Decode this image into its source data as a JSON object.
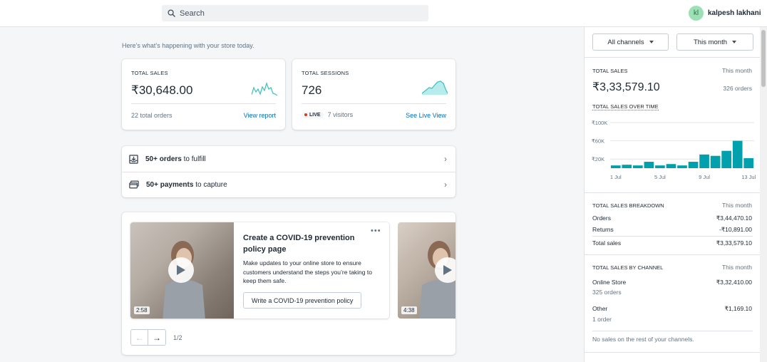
{
  "search": {
    "placeholder": "Search"
  },
  "user": {
    "initials": "kl",
    "name": "kalpesh lakhani"
  },
  "intro": "Here’s what’s happening with your store today.",
  "total_sales_card": {
    "label": "TOTAL SALES",
    "value": "₹30,648.00",
    "orders_text": "22 total orders",
    "link": "View report"
  },
  "sessions_card": {
    "label": "TOTAL SESSIONS",
    "value": "726",
    "live_label": "LIVE",
    "visitors_text": "7 visitors",
    "link": "See Live View"
  },
  "tasks": [
    {
      "count": "50+ orders",
      "rest": " to fulfill"
    },
    {
      "count": "50+ payments",
      "rest": " to capture"
    }
  ],
  "video": {
    "title": "Create a COVID-19 prevention policy page",
    "description": "Make updates to your online store to ensure customers understand the steps you’re taking to keep them safe.",
    "button": "Write a COVID-19 prevention policy",
    "duration": "2:58",
    "next_duration": "4:38",
    "menu": "•••",
    "pager_text": "1/2"
  },
  "right_panel": {
    "channel_select": "All channels",
    "period_select": "This month",
    "total_sales": {
      "label": "TOTAL SALES",
      "period": "This month",
      "value": "₹3,33,579.10",
      "orders": "326 orders",
      "over_time_label": "TOTAL SALES OVER TIME"
    },
    "breakdown": {
      "label": "TOTAL SALES BREAKDOWN",
      "period": "This month",
      "rows": [
        {
          "label": "Orders",
          "value": "₹3,44,470.10"
        },
        {
          "label": "Returns",
          "value": "-₹10,891.00"
        },
        {
          "label": "Total sales",
          "value": "₹3,33,579.10"
        }
      ]
    },
    "by_channel": {
      "label": "TOTAL SALES BY CHANNEL",
      "period": "This month",
      "channels": [
        {
          "name": "Online Store",
          "value": "₹3,32,410.00",
          "orders": "325 orders"
        },
        {
          "name": "Other",
          "value": "₹1,169.10",
          "orders": "1 order"
        }
      ],
      "note": "No sales on the rest of your channels."
    }
  },
  "colors": {
    "accent": "#47c1bf",
    "bar": "#00a0ac",
    "link": "#006fbb",
    "live": "#de3618"
  },
  "chart_data": {
    "type": "bar",
    "title": "TOTAL SALES OVER TIME",
    "x": [
      "1 Jul",
      "2 Jul",
      "3 Jul",
      "4 Jul",
      "5 Jul",
      "6 Jul",
      "7 Jul",
      "8 Jul",
      "9 Jul",
      "10 Jul",
      "11 Jul",
      "12 Jul",
      "13 Jul"
    ],
    "values": [
      6000,
      7500,
      6000,
      14000,
      6000,
      9000,
      6000,
      14000,
      30000,
      27000,
      38000,
      60000,
      22000
    ],
    "yticks": [
      "₹20K",
      "₹60K",
      "₹100K"
    ],
    "ytick_values": [
      20000,
      60000,
      100000
    ],
    "xticks": [
      "1 Jul",
      "5 Jul",
      "9 Jul",
      "13 Jul"
    ],
    "ylim": [
      0,
      100000
    ],
    "grid": true,
    "legend": "none"
  }
}
